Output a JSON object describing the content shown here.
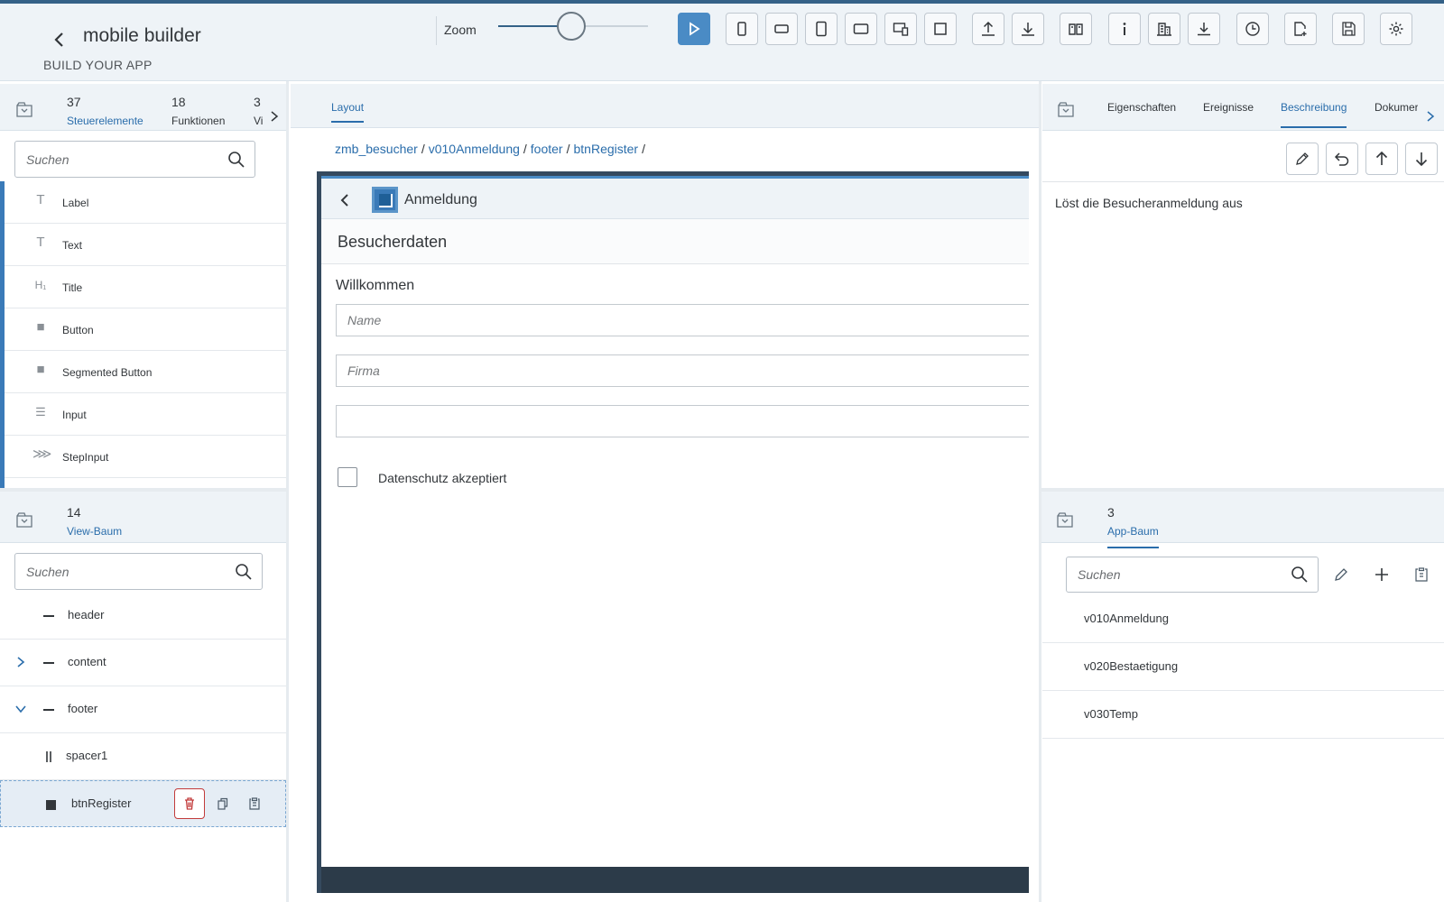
{
  "header": {
    "title": "mobile builder",
    "subtitle": "BUILD YOUR APP",
    "zoom_label": "Zoom",
    "zoom_level": 0.49,
    "accent_color": "#346187"
  },
  "toolbar": {
    "buttons": [
      "play-icon",
      "phone-portrait-icon",
      "phone-landscape-icon",
      "tablet-portrait-icon",
      "tablet-landscape-icon",
      "desktop-tablet-icon",
      "square-icon",
      "upload-icon",
      "download-icon",
      "book-icon",
      "info-icon",
      "building-icon",
      "download-tray-icon",
      "history-icon",
      "add-document-icon",
      "save-icon",
      "settings-icon"
    ]
  },
  "controls_panel": {
    "stats": [
      {
        "count": "37",
        "label": "Steuerelemente"
      },
      {
        "count": "18",
        "label": "Funktionen"
      },
      {
        "count": "3",
        "label": "Vi"
      }
    ],
    "search_placeholder": "Suchen",
    "items": [
      {
        "label": "Label",
        "icon": "T"
      },
      {
        "label": "Text",
        "icon": "T"
      },
      {
        "label": "Title",
        "icon": "H₁"
      },
      {
        "label": "Button",
        "icon": "■"
      },
      {
        "label": "Segmented Button",
        "icon": "■"
      },
      {
        "label": "Input",
        "icon": "☰"
      },
      {
        "label": "StepInput",
        "icon": "⋙"
      }
    ]
  },
  "view_tree": {
    "count": "14",
    "label": "View-Baum",
    "search_placeholder": "Suchen",
    "items": [
      {
        "label": "header"
      },
      {
        "label": "content"
      },
      {
        "label": "footer"
      },
      {
        "label": "spacer1"
      },
      {
        "label": "btnRegister"
      }
    ]
  },
  "center": {
    "tab_layout": "Layout",
    "breadcrumb": [
      "zmb_besucher",
      "v010Anmeldung",
      "footer",
      "btnRegister"
    ],
    "device": {
      "page_title": "Anmeldung",
      "section_title": "Besucherdaten",
      "welcome": "Willkommen",
      "input_name_placeholder": "Name",
      "input_firma_placeholder": "Firma",
      "input_third_value": "",
      "checkbox_label": "Datenschutz akzeptiert"
    }
  },
  "right_panel": {
    "tabs": [
      "Eigenschaften",
      "Ereignisse",
      "Beschreibung",
      "Dokumer"
    ],
    "description": "Löst die Besucheranmeldung aus"
  },
  "app_tree": {
    "count": "3",
    "label": "App-Baum",
    "search_placeholder": "Suchen",
    "items": [
      "v010Anmeldung",
      "v020Bestaetigung",
      "v030Temp"
    ]
  }
}
